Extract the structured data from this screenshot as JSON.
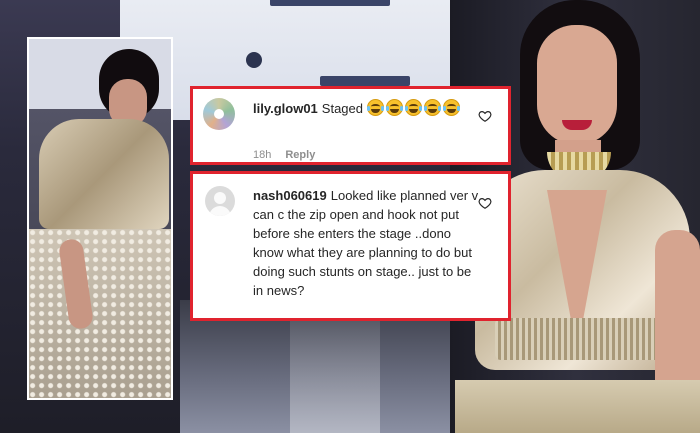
{
  "comments": [
    {
      "username": "lily.glow01",
      "text": "Staged",
      "emoji_count": 5,
      "emoji_name": "face-with-tears-of-joy",
      "time": "18h",
      "reply_label": "Reply",
      "liked": false
    },
    {
      "username": "nash060619",
      "text": "Looked like planned ver v can c the zip open and hook not put before she enters the stage ..dono know what they are planning to do but doing such stunts on stage.. just to be in news?",
      "liked": false
    }
  ],
  "colors": {
    "card_border": "#e0232e",
    "emoji": "#f7c02c"
  },
  "icons": {
    "like": "heart-outline-icon",
    "avatar_default": "default-avatar-icon"
  }
}
